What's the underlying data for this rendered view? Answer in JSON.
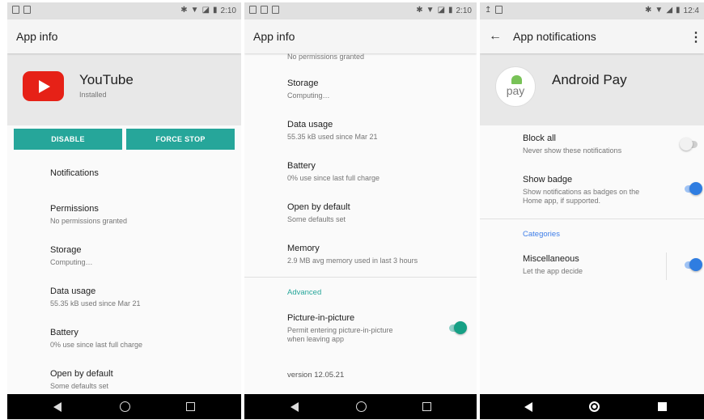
{
  "screen1": {
    "status_time": "2:10",
    "title": "App info",
    "app_name": "YouTube",
    "app_status": "Installed",
    "disable_label": "DISABLE",
    "force_stop_label": "FORCE STOP",
    "items": [
      {
        "title": "Notifications",
        "subtitle": ""
      },
      {
        "title": "Permissions",
        "subtitle": "No permissions granted"
      },
      {
        "title": "Storage",
        "subtitle": "Computing…"
      },
      {
        "title": "Data usage",
        "subtitle": "55.35 kB used since Mar 21"
      },
      {
        "title": "Battery",
        "subtitle": "0% use since last full charge"
      },
      {
        "title": "Open by default",
        "subtitle": "Some defaults set"
      }
    ]
  },
  "screen2": {
    "status_time": "2:10",
    "title": "App info",
    "clipped_text": "No permissions granted",
    "items": [
      {
        "title": "Storage",
        "subtitle": "Computing…"
      },
      {
        "title": "Data usage",
        "subtitle": "55.35 kB used since Mar 21"
      },
      {
        "title": "Battery",
        "subtitle": "0% use since last full charge"
      },
      {
        "title": "Open by default",
        "subtitle": "Some defaults set"
      },
      {
        "title": "Memory",
        "subtitle": "2.9 MB avg memory used in last 3 hours"
      }
    ],
    "advanced_label": "Advanced",
    "pip": {
      "title": "Picture-in-picture",
      "subtitle_line1": "Permit entering picture-in-picture",
      "subtitle_line2": "when leaving app",
      "enabled": true
    },
    "version": "version 12.05.21"
  },
  "screen3": {
    "status_time": "12:4",
    "title": "App notifications",
    "app_name": "Android Pay",
    "pay_logo_text": "pay",
    "block_all": {
      "title": "Block all",
      "subtitle": "Never show these notifications",
      "enabled": false
    },
    "show_badge": {
      "title": "Show badge",
      "subtitle_line1": "Show notifications as badges on the",
      "subtitle_line2": "Home app, if supported.",
      "enabled": true
    },
    "categories_label": "Categories",
    "misc": {
      "title": "Miscellaneous",
      "subtitle": "Let the app decide",
      "enabled": true
    }
  },
  "colors": {
    "accent_teal": "#26a69a",
    "toggle_blue": "#2f7de1",
    "youtube_red": "#e62117",
    "android_green": "#78c257"
  }
}
